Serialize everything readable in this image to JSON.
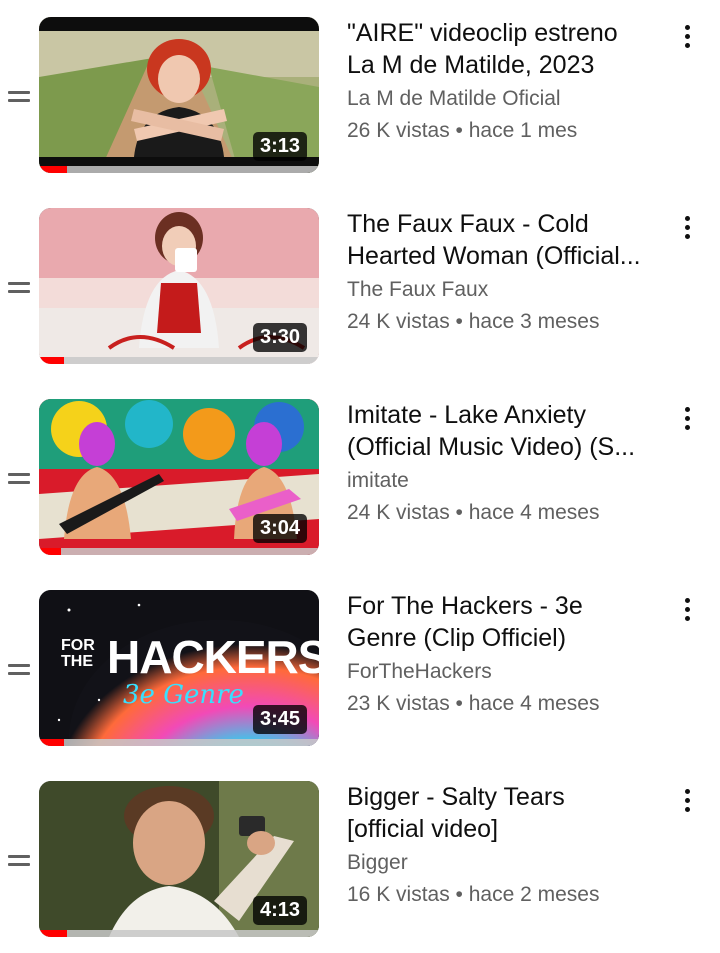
{
  "playlist": {
    "items": [
      {
        "title": "\"AIRE\" videoclip estreno La M de Matilde, 2023",
        "channel": "La M de Matilde Oficial",
        "stats": "26 K vistas • hace 1 mes",
        "duration": "3:13",
        "watched_fraction": 0.1,
        "thumbnail_icon": "thumbnail-red-haired-woman-field"
      },
      {
        "title": "The Faux Faux - Cold Hearted Woman (Official...",
        "channel": "The Faux Faux",
        "stats": "24 K vistas • hace 3 meses",
        "duration": "3:30",
        "watched_fraction": 0.09,
        "thumbnail_icon": "thumbnail-woman-drinking-cup"
      },
      {
        "title": "Imitate - Lake Anxiety (Official Music Video) (S...",
        "channel": "imitate",
        "stats": "24 K vistas • hace 4 meses",
        "duration": "3:04",
        "watched_fraction": 0.08,
        "thumbnail_icon": "thumbnail-psychedelic-guitarists"
      },
      {
        "title": "For The Hackers - 3e Genre (Clip Officiel)",
        "channel": "ForTheHackers",
        "stats": "23 K vistas • hace 4 meses",
        "duration": "3:45",
        "watched_fraction": 0.09,
        "thumbnail_icon": "thumbnail-for-the-hackers-logo",
        "thumbnail_text_small": "FOR THE",
        "thumbnail_text_big": "HACKERS",
        "thumbnail_text_script": "3e Genre"
      },
      {
        "title": "Bigger - Salty Tears [official video]",
        "channel": "Bigger",
        "stats": "16 K vistas • hace 2 meses",
        "duration": "4:13",
        "watched_fraction": 0.1,
        "thumbnail_icon": "thumbnail-man-with-gun"
      }
    ]
  },
  "colors": {
    "progress": "#ff0000",
    "secondary_text": "#606060",
    "primary_text": "#0f0f0f"
  }
}
